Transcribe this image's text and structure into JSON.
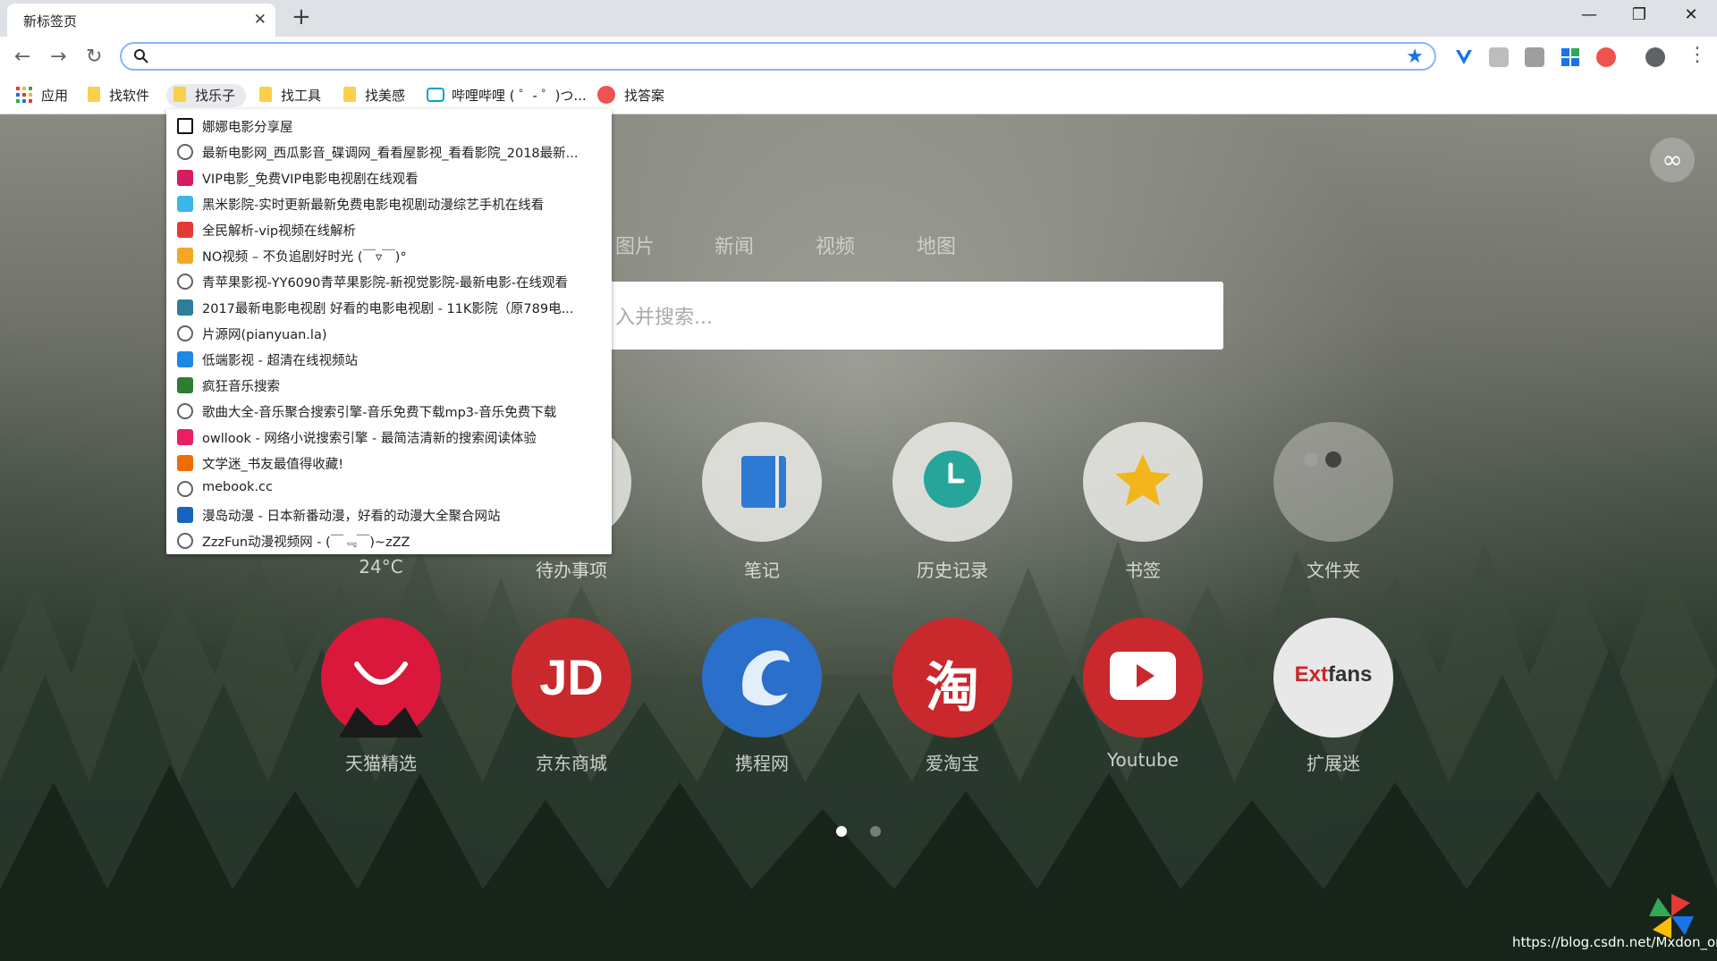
{
  "browser": {
    "tab_title": "新标签页",
    "tab_close": "✕",
    "new_tab": "+",
    "window_controls": [
      "—",
      "❐",
      "✕"
    ]
  },
  "toolbar": {
    "back": "←",
    "forward": "→",
    "reload": "↻",
    "omnibox_value": "",
    "star": "★",
    "menu": "⋮"
  },
  "bookmarks_bar": {
    "apps_label": "应用",
    "items": [
      "找软件",
      "找乐子",
      "找工具",
      "找美感",
      "哔哩哔哩 ( ゜- ゜)つ...",
      "找答案"
    ]
  },
  "dropdown": {
    "items": [
      {
        "label": "娜娜电影分享屋",
        "icon": "video-icon",
        "color": "#111111"
      },
      {
        "label": "最新电影网_西瓜影音_碟调网_看看屋影视_看看影院_2018最新...",
        "icon": "globe-icon",
        "color": "#5f6368"
      },
      {
        "label": "VIP电影_免费VIP电影电视剧在线观看",
        "icon": "vip-icon",
        "color": "#d81b60"
      },
      {
        "label": "黑米影院-实时更新最新免费电影电视剧动漫综艺手机在线看",
        "icon": "play-circle-icon",
        "color": "#3ab6e8"
      },
      {
        "label": "全民解析-vip视频在线解析",
        "icon": "v-logo-icon",
        "color": "#e53935"
      },
      {
        "label": "NO视频 – 不负追剧好时光 (￣▿￣)°",
        "icon": "orange-play-icon",
        "color": "#f5a623"
      },
      {
        "label": "青苹果影视-YY6090青苹果影院-新视觉影院-最新电影-在线观看",
        "icon": "globe-icon",
        "color": "#5f6368"
      },
      {
        "label": "2017最新电影电视剧 好看的电影电视剧 - 11K影院（原789电...",
        "icon": "film-icon",
        "color": "#2e7d9a"
      },
      {
        "label": "片源网(pianyuan.la)",
        "icon": "globe-icon",
        "color": "#5f6368"
      },
      {
        "label": "低端影视 - 超清在线视频站",
        "icon": "dd-icon",
        "color": "#1e88e5"
      },
      {
        "label": "疯狂音乐搜索",
        "icon": "music-note-icon",
        "color": "#2e7d32"
      },
      {
        "label": "歌曲大全-音乐聚合搜索引擎-音乐免费下载mp3-音乐免费下载",
        "icon": "globe-icon",
        "color": "#5f6368"
      },
      {
        "label": "owllook - 网络小说搜索引擎 - 最简洁清新的搜索阅读体验",
        "icon": "owl-icon",
        "color": "#e91e63"
      },
      {
        "label": "文学迷_书友最值得收藏!",
        "icon": "house-icon",
        "color": "#ef6c00"
      },
      {
        "label": "mebook.cc",
        "icon": "globe-icon",
        "color": "#5f6368"
      },
      {
        "label": "漫岛动漫 - 日本新番动漫，好看的动漫大全聚合网站",
        "icon": "anime-icon",
        "color": "#1565c0"
      },
      {
        "label": "ZzzFun动漫视频网 - (￣﹃￣)~zZZ",
        "icon": "globe-icon",
        "color": "#5f6368"
      }
    ]
  },
  "newtab": {
    "search_tabs": [
      "图片",
      "新闻",
      "视频",
      "地图"
    ],
    "search_placeholder": "入并搜索...",
    "row1": [
      {
        "label": "24°C"
      },
      {
        "label": "待办事项"
      },
      {
        "label": "笔记"
      },
      {
        "label": "历史记录"
      },
      {
        "label": "书签"
      },
      {
        "label": "文件夹"
      }
    ],
    "row2": [
      {
        "label": "天猫精选",
        "bg": "#d9183b"
      },
      {
        "label": "京东商城",
        "bg": "#c9282d"
      },
      {
        "label": "携程网",
        "bg": "#2a6fc9"
      },
      {
        "label": "爱淘宝",
        "bg": "#c9282d"
      },
      {
        "label": "Youtube",
        "bg": "#c9282d"
      },
      {
        "label": "扩展迷",
        "bg": "#e8e8e8"
      }
    ],
    "jd_text": "JD",
    "taobao_text": "淘",
    "extfans_text_ext": "Ext",
    "extfans_text_fans": "fans",
    "corner_icon": "∞",
    "watermark": "https://blog.csdn.net/Mxdon_on"
  }
}
